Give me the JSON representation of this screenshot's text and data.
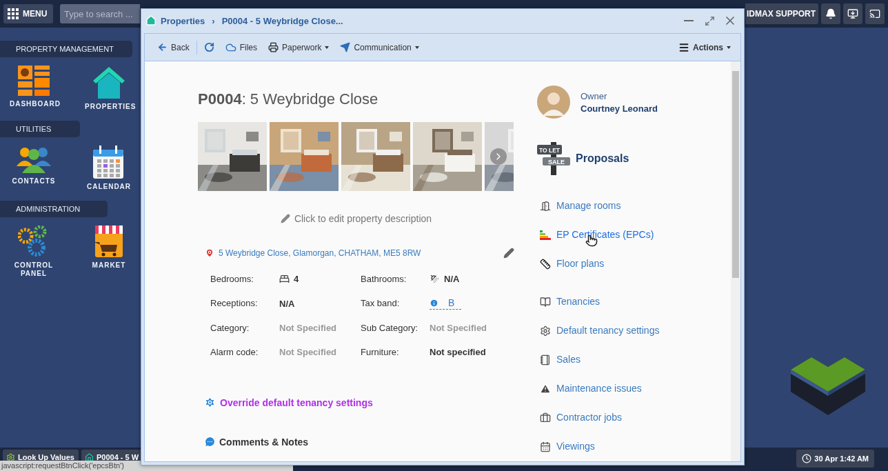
{
  "topbar": {
    "menu_label": "MENU",
    "search": {
      "placeholder": "Type to search ..."
    },
    "support_label": "IDMAX SUPPORT"
  },
  "sidebar": {
    "sections": [
      {
        "title": "PROPERTY MANAGEMENT",
        "apps": [
          {
            "kind": "dashboard",
            "label": "DASHBOARD"
          },
          {
            "kind": "properties",
            "label": "PROPERTIES"
          }
        ]
      },
      {
        "title": "UTILITIES",
        "apps": [
          {
            "kind": "contacts",
            "label": "CONTACTS"
          },
          {
            "kind": "calendar",
            "label": "CALENDAR"
          }
        ]
      },
      {
        "title": "ADMINISTRATION",
        "apps": [
          {
            "kind": "control",
            "label": "CONTROL PANEL"
          },
          {
            "kind": "market",
            "label": "MARKET"
          }
        ]
      }
    ]
  },
  "window": {
    "breadcrumb": [
      "Properties",
      "P0004 - 5 Weybridge Close..."
    ],
    "separator": "›",
    "toolbar": [
      {
        "kind": "back",
        "label": "Back",
        "dropdown": false
      },
      {
        "kind": "refresh",
        "dropdown": false
      },
      {
        "kind": "files",
        "label": "Files",
        "dropdown": false
      },
      {
        "kind": "paperwork",
        "label": "Paperwork",
        "dropdown": true
      },
      {
        "kind": "communication",
        "label": "Communication",
        "dropdown": true
      }
    ],
    "actions_label": "Actions"
  },
  "property": {
    "title": "**P0004**: 5 Weybridge Close",
    "description_placeholder": "Click to edit property description",
    "address": "5 Weybridge Close, Glamorgan, CHATHAM, ME5 8RW",
    "details": [
      {
        "label": "Bedrooms:",
        "value": "4",
        "muted": false,
        "link": false
      },
      {
        "label": "Bathrooms:",
        "value": "N/A",
        "muted": false,
        "link": false
      },
      {
        "label": "Receptions:",
        "value": "N/A",
        "muted": false,
        "link": false
      },
      {
        "label": "Tax band:",
        "value": "B",
        "muted": false,
        "link": true
      },
      {
        "label": "Category:",
        "value": "Not Specified",
        "muted": true,
        "link": false
      },
      {
        "label": "Sub Category:",
        "value": "Not Specified",
        "muted": true,
        "link": false
      },
      {
        "label": "Alarm code:",
        "value": "Not Specified",
        "muted": true,
        "link": false
      },
      {
        "label": "Furniture:",
        "value": "Not specified",
        "muted": false,
        "link": false
      }
    ],
    "override_link": "Override default tenancy settings",
    "comments_heading": "Comments & Notes"
  },
  "owner": {
    "role": "Owner",
    "name": "Courtney Leonard"
  },
  "proposals": {
    "title": "Proposals",
    "sign": [
      "TO LET",
      "SALE"
    ]
  },
  "link_groups": [
    [
      {
        "kind": "rooms",
        "label": "Manage rooms",
        "hovered": false
      },
      {
        "kind": "epc",
        "label": "EP Certificates (EPCs)",
        "hovered": true
      },
      {
        "kind": "floor",
        "label": "Floor plans",
        "hovered": false
      }
    ],
    [
      {
        "kind": "tenancies",
        "label": "Tenancies",
        "hovered": false
      },
      {
        "kind": "settings",
        "label": "Default tenancy settings",
        "hovered": false
      },
      {
        "kind": "sales",
        "label": "Sales",
        "hovered": false
      },
      {
        "kind": "maintenance",
        "label": "Maintenance issues",
        "hovered": false
      },
      {
        "kind": "contractor",
        "label": "Contractor jobs",
        "hovered": false
      },
      {
        "kind": "viewings",
        "label": "Viewings",
        "hovered": false
      }
    ]
  ],
  "taskbar": {
    "items": [
      {
        "kind": "lookup",
        "label": "Look Up Values"
      },
      {
        "kind": "property",
        "label": "P0004 - 5 W"
      }
    ],
    "clock": "30 Apr 1:42 AM"
  },
  "status_url": "javascript:requestBtnClick('epcsBtn')"
}
